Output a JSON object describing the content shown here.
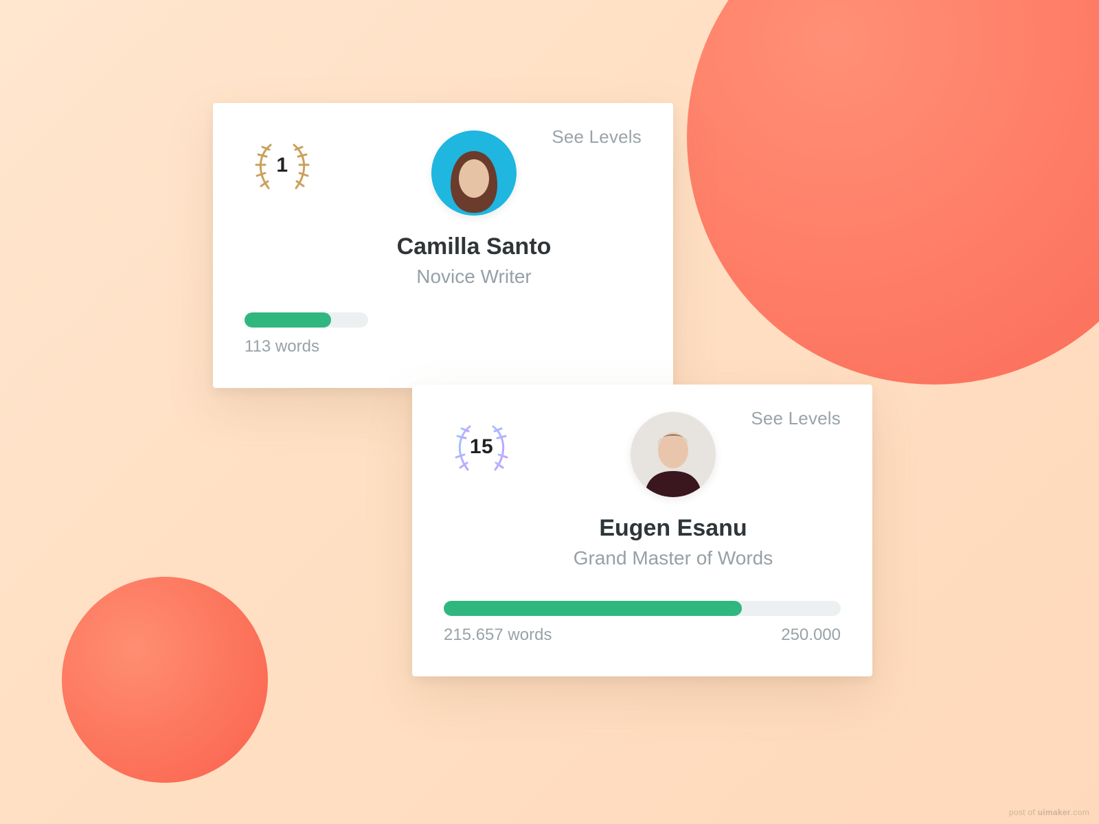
{
  "see_levels_label": "See Levels",
  "progress_accent": "#30b780",
  "laurel_color_card1": "#caa05a",
  "laurel_gradient_card2": {
    "from": "#9ec7ff",
    "to": "#c79bff"
  },
  "cards": [
    {
      "level_number": "1",
      "name": "Camilla Santo",
      "title": "Novice Writer",
      "words_label": "113 words",
      "goal_label": "",
      "progress_pct": 70,
      "avatar_bg": "#1fb6e0",
      "avatar_face": "#e7c3a6",
      "avatar_hair": "#6b3b2b"
    },
    {
      "level_number": "15",
      "name": "Eugen Esanu",
      "title": "Grand Master of Words",
      "words_label": "215.657 words",
      "goal_label": "250.000",
      "progress_pct": 75,
      "avatar_bg": "#e7e3de",
      "avatar_face": "#e9c6ab",
      "avatar_hair": "#2b2320",
      "avatar_shirt": "#3a161f"
    }
  ],
  "footer_credit_prefix": "post of ",
  "footer_credit_bold": "uimaker",
  "footer_credit_suffix": ".com"
}
